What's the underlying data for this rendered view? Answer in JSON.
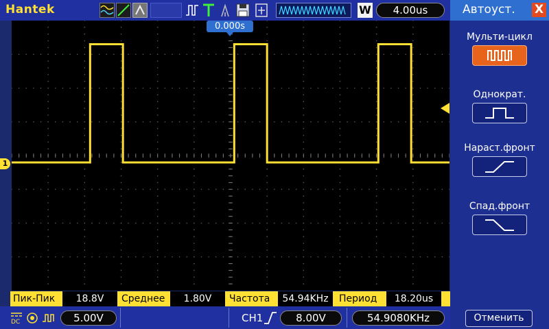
{
  "topbar": {
    "brand": "Hantek",
    "wave_mode_icon": "W",
    "timebase": "4.00us"
  },
  "screen": {
    "trigger_position": "0.000s",
    "channel_marker": "1"
  },
  "measurements": [
    {
      "label": "Пик-Пик",
      "value": "18.8V"
    },
    {
      "label": "Среднее",
      "value": "1.80V"
    },
    {
      "label": "Частота",
      "value": "54.94KHz"
    },
    {
      "label": "Период",
      "value": "18.20us"
    }
  ],
  "bottombar": {
    "volts_div": "5.00V",
    "trigger_source": "CH1",
    "trigger_level": "8.00V",
    "frequency_counter": "54.9080KHz"
  },
  "sidepanel": {
    "title": "Автоуст.",
    "close_symbol": "X",
    "options": [
      {
        "label": "Мульти-цикл",
        "icon": "multi-cycle-wave-icon",
        "active": true
      },
      {
        "label": "Однократ.",
        "icon": "single-pulse-icon",
        "active": false
      },
      {
        "label": "Нараст.фронт",
        "icon": "rising-edge-icon",
        "active": false
      },
      {
        "label": "Спад.фронт",
        "icon": "falling-edge-icon",
        "active": false
      }
    ],
    "cancel_label": "Отменить"
  },
  "colors": {
    "trace": "#ffe033",
    "accent": "#2f6fd0",
    "active_button": "#e8641c",
    "panel": "#1e2f92"
  },
  "waveform": {
    "type": "square",
    "high_level_div": 3.3,
    "low_level_div": 0,
    "pulse_starts_div": [
      -3.85,
      0.1,
      4.05
    ],
    "pulse_width_div": 0.9
  }
}
